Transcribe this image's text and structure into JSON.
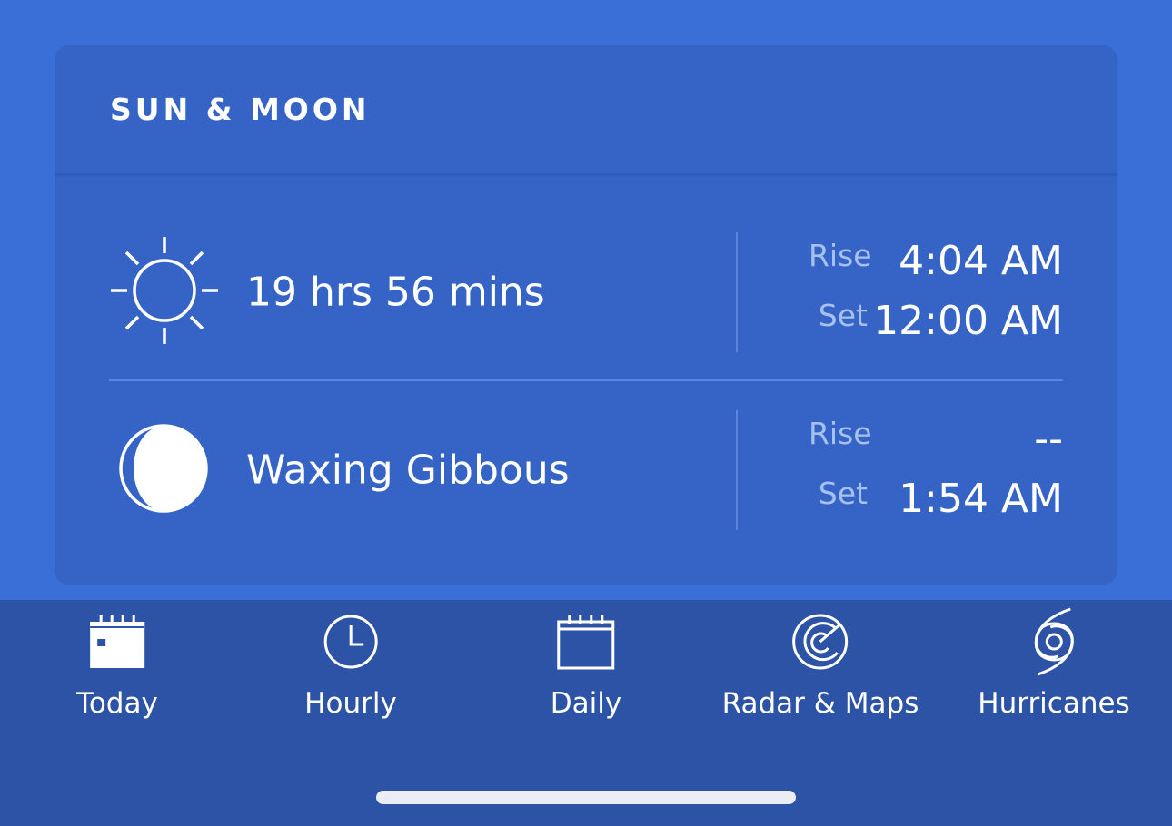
{
  "card": {
    "title": "SUN & MOON",
    "sun": {
      "icon": "sun-icon",
      "label": "19 hrs 56 mins",
      "rise_label": "Rise",
      "rise_value": "4:04 AM",
      "set_label": "Set",
      "set_value": "12:00 AM"
    },
    "moon": {
      "icon": "moon-phase-icon",
      "label": "Waxing Gibbous",
      "rise_label": "Rise",
      "rise_value": "--",
      "set_label": "Set",
      "set_value": "1:54 AM"
    }
  },
  "nav": {
    "items": [
      {
        "label": "Today",
        "icon": "calendar-today-icon"
      },
      {
        "label": "Hourly",
        "icon": "clock-icon"
      },
      {
        "label": "Daily",
        "icon": "calendar-icon"
      },
      {
        "label": "Radar & Maps",
        "icon": "radar-icon"
      },
      {
        "label": "Hurricanes",
        "icon": "hurricane-icon"
      }
    ]
  },
  "colors": {
    "background": "#3a6fd8",
    "card": "#3564c6",
    "navbar": "#2c53a5",
    "muted_label": "#a6c1ef"
  }
}
